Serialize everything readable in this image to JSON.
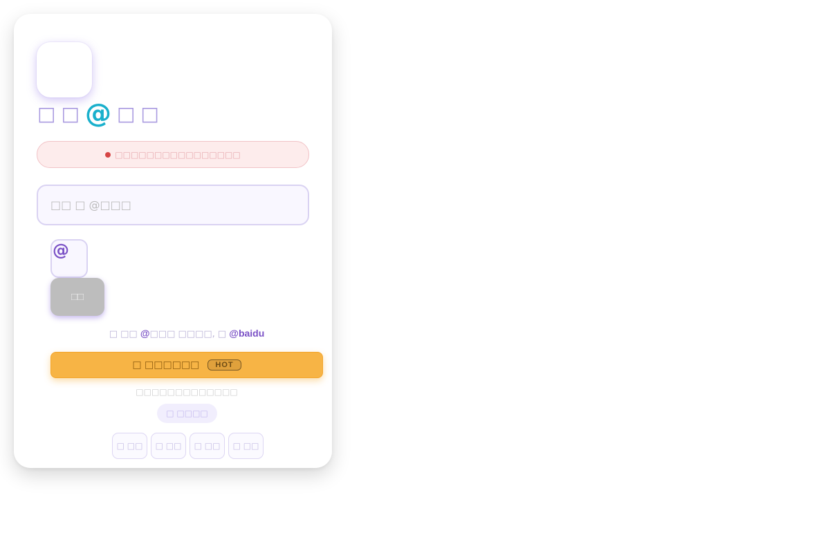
{
  "logo": {
    "icon": "app-logo-icon"
  },
  "header": {
    "title_parts": [
      "□",
      "□",
      "@",
      "□",
      "□"
    ]
  },
  "alert": {
    "text": "□□□□□□□□□□□□□□□□",
    "dot_color": "#d64545"
  },
  "username_input": {
    "value": "",
    "placeholder": "□□ □ @□□□"
  },
  "suffix": {
    "label": "@"
  },
  "submit_button": {
    "label": "□□"
  },
  "hint": {
    "prefix": "□ □□ ",
    "highlight_1": "@",
    "middle": "□□□ □□□□, □ ",
    "highlight_2": "@baidu"
  },
  "promo_button": {
    "label": "□ □□□□□□",
    "badge": "HOT"
  },
  "sub_text": "□□□□□□□□□□□□□",
  "pill_button": {
    "label": "□ □□□□"
  },
  "nav": {
    "items": [
      {
        "label": "□ □□"
      },
      {
        "label": "□ □□"
      },
      {
        "label": "□ □□"
      },
      {
        "label": "□ □□"
      }
    ]
  },
  "colors": {
    "accent": "#7b52c6",
    "at_sign": "#1ab0cc",
    "promo": "#f7b445",
    "alert_bg": "#fdecec"
  }
}
